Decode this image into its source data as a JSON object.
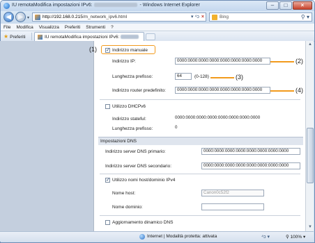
{
  "window": {
    "title_prefix": "IU remotaModifica impostazioni IPv6:",
    "title_suffix": " - Windows Internet Explorer",
    "minimize": "–",
    "maximize": "□",
    "close": "×"
  },
  "toolbar": {
    "back": "◀",
    "forward": "▶",
    "dropdown": "▾",
    "address_host": "http://192.168.0.215",
    "address_path": "/m_network_ipv6.html",
    "address_controls": "▾ ⁴ↄ",
    "address_stop": "×",
    "search_placeholder": "Bing",
    "search_glyph": "⚲ ▾"
  },
  "menu": [
    "File",
    "Modifica",
    "Visualizza",
    "Preferiti",
    "Strumenti",
    "?"
  ],
  "favorites": {
    "button_label": "Preferiti",
    "tab_label": "IU remotaModifica impostazioni IPv6:"
  },
  "form": {
    "manual_address_label": "Indirizzo manuale",
    "ip_label": "Indirizzo IP:",
    "ip_value": "0000:0000:0000:0000:0000:0000:0000:0000",
    "prefix_label": "Lunghezza prefisso:",
    "prefix_value": "64",
    "prefix_range": "(0-128)",
    "router_label": "Indirizzo router predefinito:",
    "router_value": "0000:0000:0000:0000:0000:0000:0000:0000",
    "dhcp_label": "Utilizzo DHCPv6",
    "stateful_label": "Indirizzo stateful:",
    "stateful_value": "0000:0000:0000:0000:0000:0000:0000:0000",
    "stateful_prefix_label": "Lunghezza prefisso:",
    "stateful_prefix_value": "0",
    "dns_section": "Impostazioni DNS",
    "dns_primary_label": "Indirizzo server DNS primario:",
    "dns_primary_value": "0000:0000:0000:0000:0000:0000:0000:0000",
    "dns_secondary_label": "Indirizzo server DNS secondario:",
    "dns_secondary_value": "0000:0000:0000:0000:0000:0000:0000:0000",
    "use_ipv4_names_label": "Utilizzo nomi host/dominio IPv4",
    "host_name_label": "Nome host:",
    "host_name_value": "Canon0c52f2",
    "domain_name_label": "Nome dominio:",
    "domain_name_value": "",
    "dynamic_dns_label": "Aggiornamento dinamico DNS"
  },
  "callouts": {
    "one": "(1)",
    "two": "(2)",
    "three": "(3)",
    "four": "(4)"
  },
  "status": {
    "text": "Internet | Modalità protetta: attivata",
    "zoom_controls": "⁴ↄ ▾",
    "zoom": "⚲ 100% ▾"
  },
  "colors": {
    "callout": "#f29a1c",
    "left_pane": "#c4cfde"
  }
}
